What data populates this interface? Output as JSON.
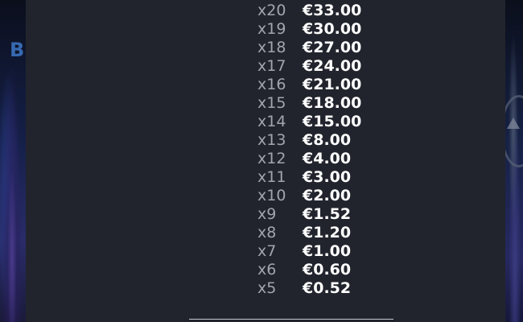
{
  "background": {
    "left_title_fragment": "Bl"
  },
  "paytable": {
    "rows": [
      {
        "multiplier": "x20",
        "amount": "€33.00"
      },
      {
        "multiplier": "x19",
        "amount": "€30.00"
      },
      {
        "multiplier": "x18",
        "amount": "€27.00"
      },
      {
        "multiplier": "x17",
        "amount": "€24.00"
      },
      {
        "multiplier": "x16",
        "amount": "€21.00"
      },
      {
        "multiplier": "x15",
        "amount": "€18.00"
      },
      {
        "multiplier": "x14",
        "amount": "€15.00"
      },
      {
        "multiplier": "x13",
        "amount": "€8.00"
      },
      {
        "multiplier": "x12",
        "amount": "€4.00"
      },
      {
        "multiplier": "x11",
        "amount": "€3.00"
      },
      {
        "multiplier": "x10",
        "amount": "€2.00"
      },
      {
        "multiplier": "x9",
        "amount": "€1.52"
      },
      {
        "multiplier": "x8",
        "amount": "€1.20"
      },
      {
        "multiplier": "x7",
        "amount": "€1.00"
      },
      {
        "multiplier": "x6",
        "amount": "€0.60"
      },
      {
        "multiplier": "x5",
        "amount": "€0.52"
      }
    ]
  },
  "colors": {
    "panel_background": "#22242d",
    "multiplier_text": "#a2a4ae",
    "amount_text": "#ffffff"
  }
}
